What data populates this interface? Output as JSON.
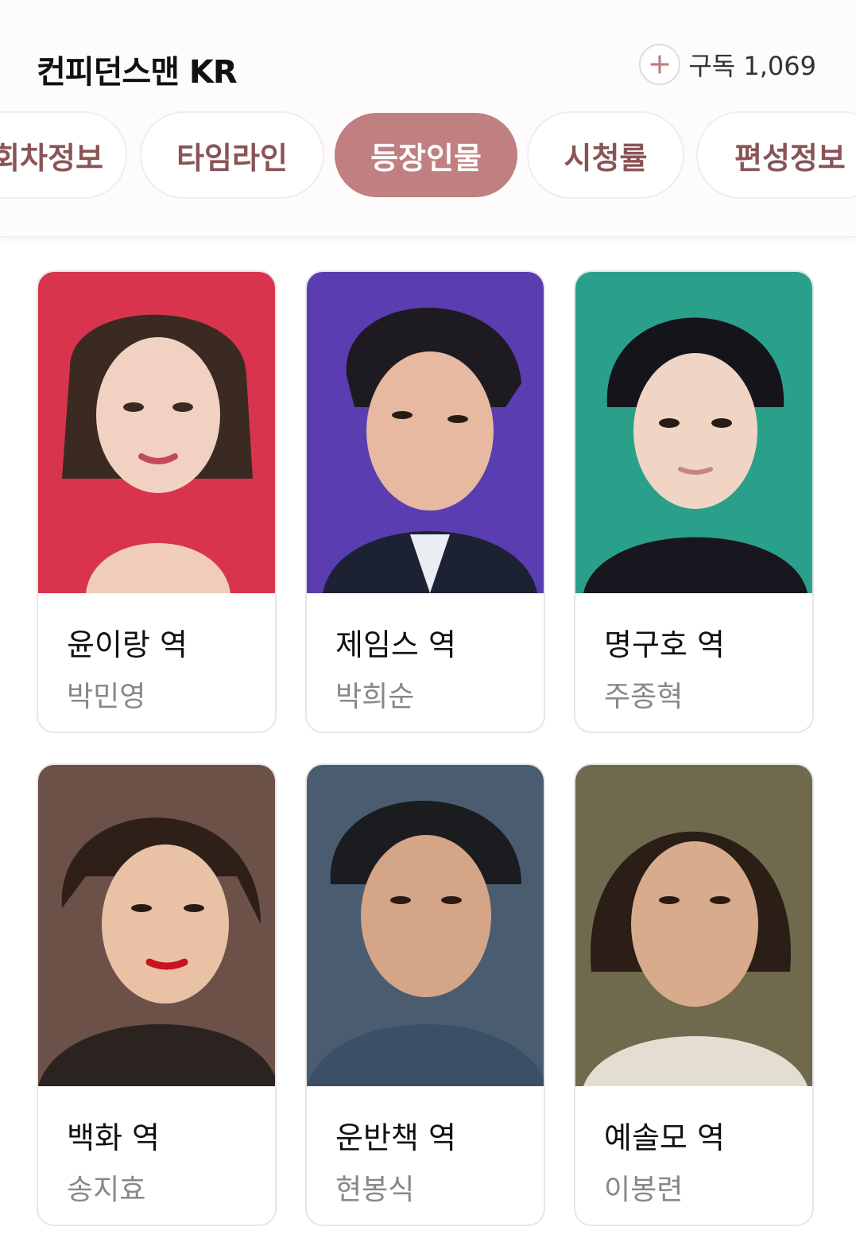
{
  "header": {
    "title": "컨피던스맨 KR",
    "subscribe_label": "구독 1,069"
  },
  "tabs": [
    {
      "label": "회차정보"
    },
    {
      "label": "타임라인"
    },
    {
      "label": "등장인물",
      "active": true
    },
    {
      "label": "시청률"
    },
    {
      "label": "편성정보"
    }
  ],
  "characters": [
    {
      "role": "윤이랑 역",
      "actor": "박민영",
      "bg": "#d9344e"
    },
    {
      "role": "제임스 역",
      "actor": "박희순",
      "bg": "#5a3db0"
    },
    {
      "role": "명구호 역",
      "actor": "주종혁",
      "bg": "#2aa08a"
    },
    {
      "role": "백화 역",
      "actor": "송지효",
      "bg": "#6b5148"
    },
    {
      "role": "운반책 역",
      "actor": "현봉식",
      "bg": "#4a5d70"
    },
    {
      "role": "예솔모 역",
      "actor": "이봉련",
      "bg": "#6f6a4e"
    }
  ]
}
